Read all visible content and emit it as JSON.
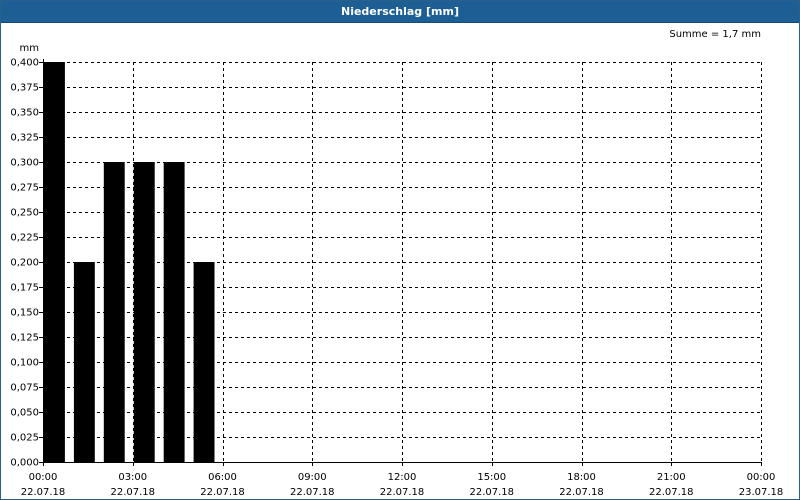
{
  "window": {
    "title": "Niederschlag [mm]"
  },
  "chart_data": {
    "type": "bar",
    "title": "Niederschlag [mm]",
    "ylabel": "mm",
    "annotation": "Summe = 1,7 mm",
    "ylim": [
      0,
      0.4
    ],
    "y_ticks": [
      "0,000",
      "0,025",
      "0,050",
      "0,075",
      "0,100",
      "0,125",
      "0,150",
      "0,175",
      "0,200",
      "0,225",
      "0,250",
      "0,275",
      "0,300",
      "0,325",
      "0,350",
      "0,375",
      "0,400"
    ],
    "x_ticks": [
      {
        "time": "00:00",
        "date": "22.07.18"
      },
      {
        "time": "03:00",
        "date": "22.07.18"
      },
      {
        "time": "06:00",
        "date": "22.07.18"
      },
      {
        "time": "09:00",
        "date": "22.07.18"
      },
      {
        "time": "12:00",
        "date": "22.07.18"
      },
      {
        "time": "15:00",
        "date": "22.07.18"
      },
      {
        "time": "18:00",
        "date": "22.07.18"
      },
      {
        "time": "21:00",
        "date": "22.07.18"
      },
      {
        "time": "00:00",
        "date": "23.07.18"
      }
    ],
    "x_range_hours": [
      0,
      24
    ],
    "categories": [
      "00:00",
      "01:00",
      "02:00",
      "03:00",
      "04:00",
      "05:00"
    ],
    "values": [
      0.4,
      0.2,
      0.3,
      0.3,
      0.3,
      0.2
    ],
    "grid": true,
    "bar_color": "#000000",
    "grid_color": "#000000"
  }
}
